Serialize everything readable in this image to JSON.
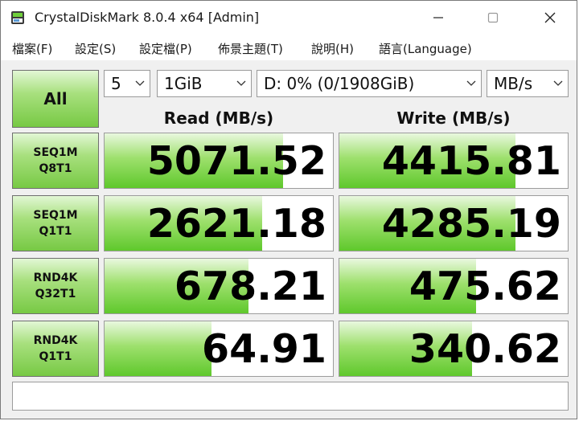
{
  "window": {
    "title": "CrystalDiskMark 8.0.4 x64 [Admin]"
  },
  "menu": [
    "檔案(F)",
    "設定(S)",
    "設定檔(P)",
    "佈景主題(T)",
    "說明(H)",
    "語言(Language)"
  ],
  "controls": {
    "all_label": "All",
    "count": "5",
    "size": "1GiB",
    "drive": "D: 0% (0/1908GiB)",
    "unit": "MB/s"
  },
  "headers": {
    "read": "Read (MB/s)",
    "write": "Write (MB/s)"
  },
  "tests": [
    {
      "line1": "SEQ1M",
      "line2": "Q8T1",
      "read": "5071.52",
      "write": "4415.81",
      "read_fill": 0.78,
      "write_fill": 0.77
    },
    {
      "line1": "SEQ1M",
      "line2": "Q1T1",
      "read": "2621.18",
      "write": "4285.19",
      "read_fill": 0.69,
      "write_fill": 0.77
    },
    {
      "line1": "RND4K",
      "line2": "Q32T1",
      "read": "678.21",
      "write": "475.62",
      "read_fill": 0.63,
      "write_fill": 0.6
    },
    {
      "line1": "RND4K",
      "line2": "Q1T1",
      "read": "64.91",
      "write": "340.62",
      "read_fill": 0.47,
      "write_fill": 0.58
    }
  ],
  "comment": ""
}
